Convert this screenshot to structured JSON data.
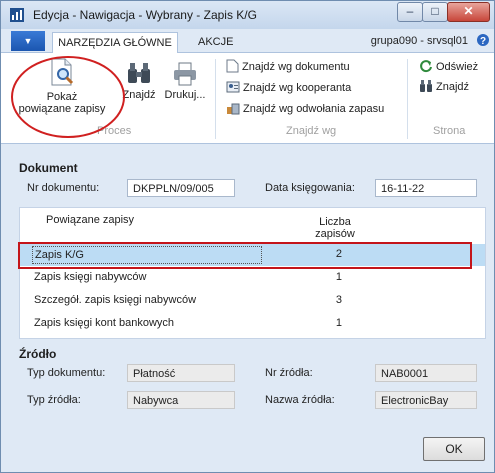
{
  "window": {
    "title": "Edycja - Nawigacja - Wybrany - Zapis K/G",
    "min": "–",
    "max": "□",
    "close": "✕"
  },
  "ribbon": {
    "app_menu": "▼",
    "tabs": [
      {
        "label": "NARZĘDZIA GŁÓWNE",
        "active": true
      },
      {
        "label": "AKCJE",
        "active": false
      }
    ],
    "server": "grupa090 - srvsql01",
    "groups": {
      "proces": {
        "label": "Proces",
        "buttons": [
          {
            "label_line1": "Pokaż",
            "label_line2": "powiązane zapisy",
            "icon": "search-document-icon"
          },
          {
            "label": "Znajdź",
            "icon": "binoculars-icon"
          },
          {
            "label": "Drukuj...",
            "icon": "printer-icon"
          }
        ]
      },
      "znajdz_wg": {
        "label": "Znajdź wg",
        "buttons": [
          {
            "label": "Znajdź wg dokumentu",
            "icon": "document-icon"
          },
          {
            "label": "Znajdź wg kooperanta",
            "icon": "contact-card-icon"
          },
          {
            "label": "Znajdź wg odwołania zapasu",
            "icon": "inventory-icon"
          }
        ]
      },
      "strona": {
        "label": "Strona",
        "buttons": [
          {
            "label": "Odśwież",
            "icon": "refresh-icon"
          },
          {
            "label": "Znajdź",
            "icon": "binoculars-icon"
          }
        ]
      }
    }
  },
  "dokument": {
    "title": "Dokument",
    "nr_label": "Nr dokumentu:",
    "nr_value": "DKPPLN/09/005",
    "data_label": "Data księgowania:",
    "data_value": "16-11-22",
    "grid": {
      "col1": "Powiązane zapisy",
      "col2_line1": "Liczba",
      "col2_line2": "zapisów",
      "rows": [
        {
          "name": "Zapis K/G",
          "count": "2",
          "selected": true
        },
        {
          "name": "Zapis księgi nabywców",
          "count": "1"
        },
        {
          "name": "Szczegół. zapis księgi nabywców",
          "count": "3"
        },
        {
          "name": "Zapis księgi kont bankowych",
          "count": "1"
        }
      ]
    }
  },
  "zrodlo": {
    "title": "Źródło",
    "typ_dok_label": "Typ dokumentu:",
    "typ_dok_value": "Płatność",
    "nr_zrodla_label": "Nr źródła:",
    "nr_zrodla_value": "NAB0001",
    "typ_zrodla_label": "Typ źródła:",
    "typ_zrodla_value": "Nabywca",
    "nazwa_zrodla_label": "Nazwa źródła:",
    "nazwa_zrodla_value": "ElectronicBay"
  },
  "ok_label": "OK",
  "colors": {
    "accent": "#1b56b0",
    "selection": "#bcdcf4",
    "highlight": "#c4151a"
  }
}
